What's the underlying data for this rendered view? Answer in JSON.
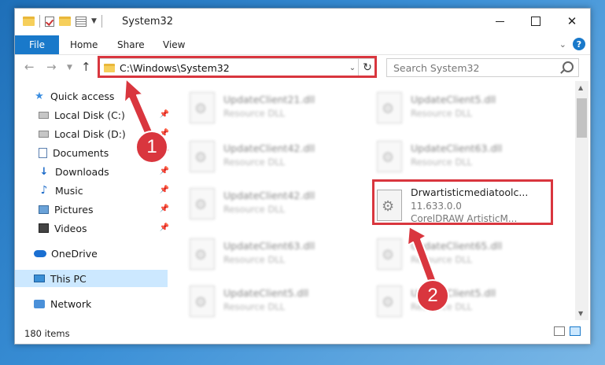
{
  "window": {
    "title": "System32",
    "minimize_glyph": "",
    "maximize_glyph": "",
    "close_glyph": "✕"
  },
  "ribbon": {
    "tabs": [
      {
        "label": "File"
      },
      {
        "label": "Home"
      },
      {
        "label": "Share"
      },
      {
        "label": "View"
      }
    ],
    "help_label": "?"
  },
  "address": {
    "path": "C:\\Windows\\System32",
    "search_placeholder": "Search System32"
  },
  "nav_pane": {
    "items": [
      {
        "label": "Quick access",
        "icon": "star-icon"
      },
      {
        "label": "Local Disk (C:)",
        "icon": "disk-icon",
        "pinned": true
      },
      {
        "label": "Local Disk (D:)",
        "icon": "disk-icon",
        "pinned": true
      },
      {
        "label": "Documents",
        "icon": "documents-icon",
        "pinned": true
      },
      {
        "label": "Downloads",
        "icon": "download-icon",
        "pinned": true
      },
      {
        "label": "Music",
        "icon": "music-icon",
        "pinned": true
      },
      {
        "label": "Pictures",
        "icon": "pictures-icon",
        "pinned": true
      },
      {
        "label": "Videos",
        "icon": "videos-icon",
        "pinned": true
      },
      {
        "label": "OneDrive",
        "icon": "cloud-icon"
      },
      {
        "label": "This PC",
        "icon": "pc-icon",
        "selected": true
      },
      {
        "label": "Network",
        "icon": "network-icon"
      }
    ]
  },
  "files": [
    {
      "name": "UpdateClient21.dll",
      "desc": "Resource DLL",
      "blurred": true
    },
    {
      "name": "UpdateClient5.dll",
      "desc": "Resource DLL",
      "blurred": true
    },
    {
      "name": "UpdateClient42.dll",
      "desc": "Resource DLL",
      "blurred": true
    },
    {
      "name": "UpdateClient63.dll",
      "desc": "Resource DLL",
      "blurred": true
    },
    {
      "name": "UpdateClient42.dll",
      "desc": "Resource DLL",
      "blurred": true
    },
    {
      "name": "Drwartisticmediatoolc...",
      "desc": "11.633.0.0",
      "extra": "CorelDRAW ArtisticM...",
      "blurred": false
    },
    {
      "name": "UpdateClient63.dll",
      "desc": "Resource DLL",
      "blurred": true
    },
    {
      "name": "UpdateClient65.dll",
      "desc": "Resource DLL",
      "blurred": true
    },
    {
      "name": "UpdateClient5.dll",
      "desc": "Resource DLL",
      "blurred": true
    },
    {
      "name": "UpdateClient5.dll",
      "desc": "Resource DLL",
      "blurred": true
    }
  ],
  "status": {
    "item_count": "180 items"
  },
  "annotations": {
    "step1": "1",
    "step2": "2",
    "color": "#d9363e"
  }
}
